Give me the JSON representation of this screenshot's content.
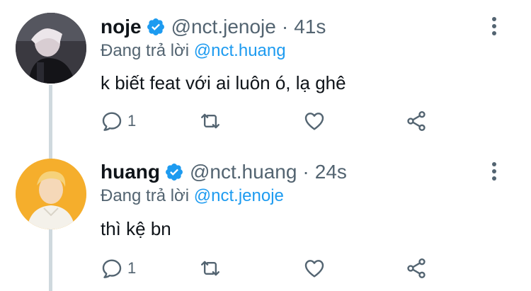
{
  "tweets": [
    {
      "name": "noje",
      "handle": "@nct.jenoje",
      "separator": "·",
      "time": "41s",
      "reply_prefix": "Đang trả lời ",
      "reply_mention": "@nct.huang",
      "text": "k biết feat với ai luôn ó, lạ ghê",
      "reply_count": "1",
      "avatar_desc": "dark stage photo avatar"
    },
    {
      "name": "huang",
      "handle": "@nct.huang",
      "separator": "·",
      "time": "24s",
      "reply_prefix": "Đang trả lời ",
      "reply_mention": "@nct.jenoje",
      "text": "thì kệ bn",
      "reply_count": "1",
      "avatar_desc": "orange background portrait avatar"
    }
  ],
  "colors": {
    "accent": "#1d9bf0",
    "secondary_text": "#536471",
    "thread_line": "#cfd9de"
  }
}
